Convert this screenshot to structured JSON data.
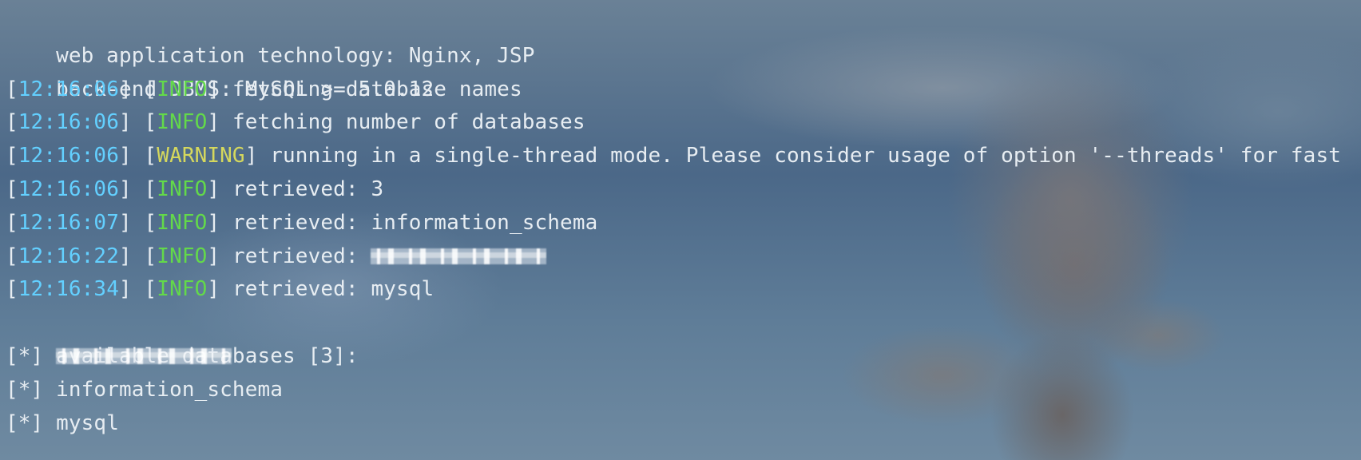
{
  "terminal": {
    "lines": [
      {
        "text": "web application technology: Nginx, JSP"
      },
      {
        "text": "back-end DBMS: MySQL >= 5.0.12"
      },
      {
        "time": "12:16:06",
        "level": "INFO",
        "message": "fetching database names"
      },
      {
        "time": "12:16:06",
        "level": "INFO",
        "message": "fetching number of databases"
      },
      {
        "time": "12:16:06",
        "level": "WARNING",
        "message": "running in a single-thread mode. Please consider usage of option '--threads' for fast"
      },
      {
        "time": "12:16:06",
        "level": "INFO",
        "message": "retrieved: 3"
      },
      {
        "time": "12:16:07",
        "level": "INFO",
        "message": "retrieved: information_schema"
      },
      {
        "time": "12:16:22",
        "level": "INFO",
        "message": "retrieved:"
      },
      {
        "time": "12:16:34",
        "level": "INFO",
        "message": "retrieved: mysql"
      },
      {
        "text": "available databases [3]:"
      },
      {
        "prefix": "[*]"
      },
      {
        "prefix": "[*]",
        "text": "information_schema"
      },
      {
        "prefix": "[*]",
        "text": "mysql"
      }
    ]
  }
}
